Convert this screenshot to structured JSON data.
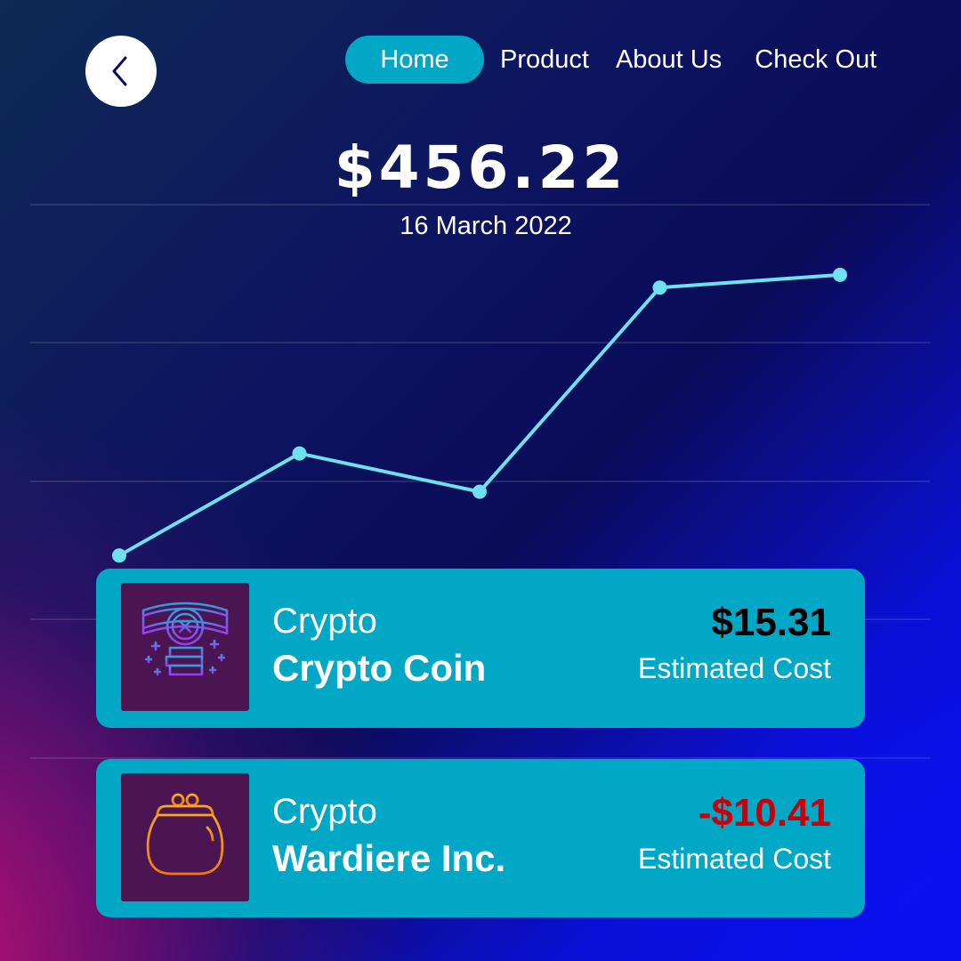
{
  "nav": {
    "back_icon": "chevron-left-icon",
    "items": [
      {
        "label": "Home",
        "active": true
      },
      {
        "label": "Product",
        "active": false
      },
      {
        "label": "About Us",
        "active": false
      },
      {
        "label": "Check Out",
        "active": false
      }
    ]
  },
  "summary": {
    "price": "$456.22",
    "date": "16 March 2022"
  },
  "chart_data": {
    "type": "line",
    "title": "",
    "xlabel": "",
    "ylabel": "",
    "x": [
      1,
      2,
      3,
      4,
      5
    ],
    "series": [
      {
        "values": [
          1.0,
          2.6,
          2.0,
          5.2,
          5.4
        ]
      }
    ],
    "ylim": [
      0,
      6.5
    ],
    "grid": true,
    "legend": "none"
  },
  "assets": [
    {
      "category": "Crypto",
      "name": "Crypto Coin",
      "value": "$15.31",
      "value_status": "positive",
      "subtitle": "Estimated Cost",
      "icon": "coin-stack-icon"
    },
    {
      "category": "Crypto",
      "name": "Wardiere Inc.",
      "value": "-$10.41",
      "value_status": "negative",
      "subtitle": "Estimated Cost",
      "icon": "coin-purse-icon"
    }
  ],
  "colors": {
    "accent": "#00a8c6",
    "chart_line": "#6ee0ee",
    "negative": "#c8000a",
    "icon_tile": "#4a1550"
  }
}
